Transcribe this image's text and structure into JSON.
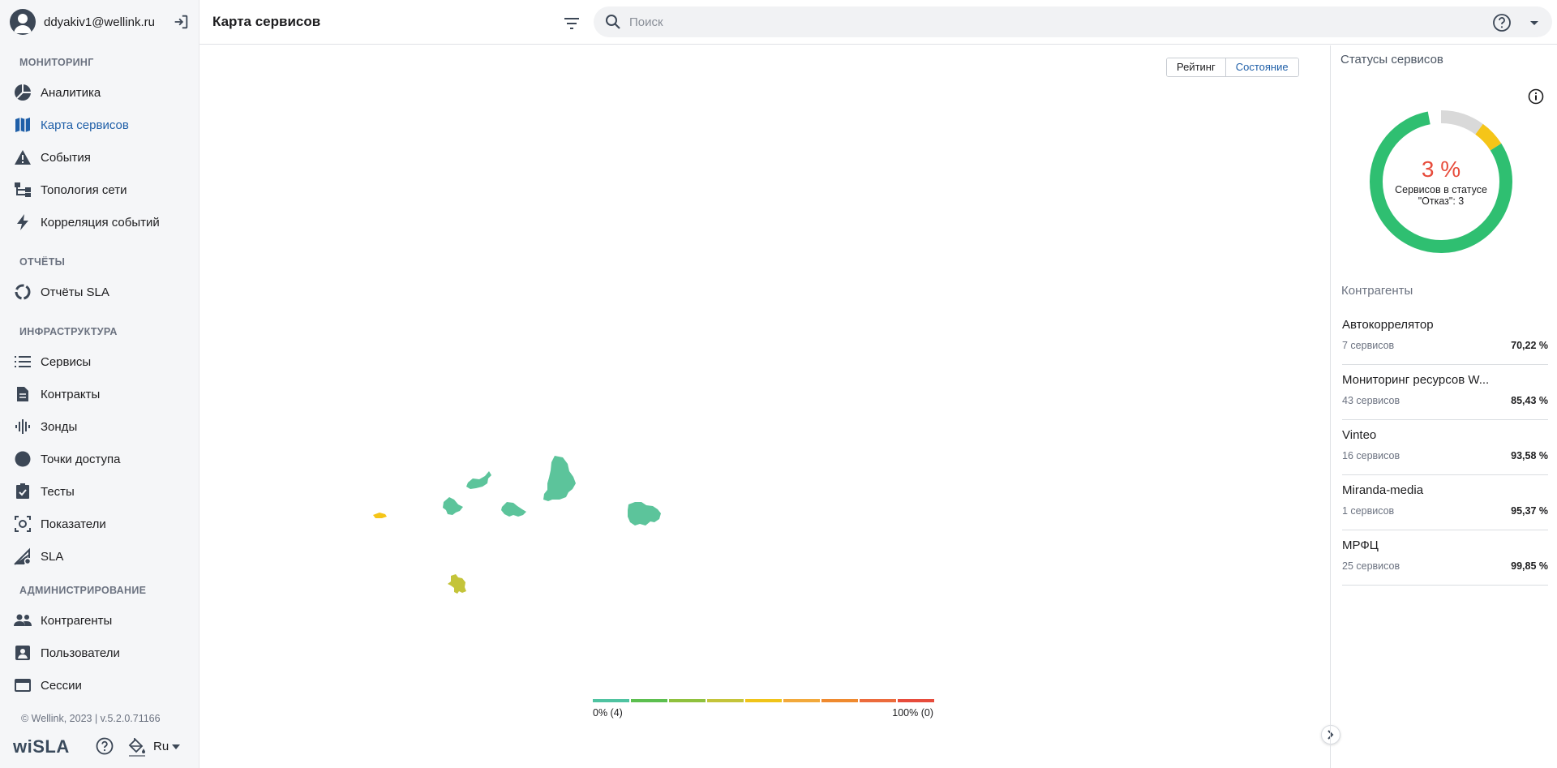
{
  "user": {
    "email": "ddyakiv1@wellink.ru"
  },
  "sidebar": {
    "sections": [
      {
        "title": "МОНИТОРИНГ"
      },
      {
        "title": "ОТЧЁТЫ"
      },
      {
        "title": "ИНФРАСТРУКТУРА"
      },
      {
        "title": "АДМИНИСТРИРОВАНИЕ"
      }
    ],
    "items": [
      {
        "label": "Аналитика",
        "icon": "analytics-icon"
      },
      {
        "label": "Карта сервисов",
        "icon": "map-icon",
        "active": true
      },
      {
        "label": "События",
        "icon": "warning-icon"
      },
      {
        "label": "Топология сети",
        "icon": "topology-icon"
      },
      {
        "label": "Корреляция событий",
        "icon": "lightning-icon"
      },
      {
        "label": "Отчёты SLA",
        "icon": "report-icon"
      },
      {
        "label": "Сервисы",
        "icon": "list-icon"
      },
      {
        "label": "Контракты",
        "icon": "document-icon"
      },
      {
        "label": "Зонды",
        "icon": "probe-icon"
      },
      {
        "label": "Точки доступа",
        "icon": "circle-icon"
      },
      {
        "label": "Тесты",
        "icon": "checklist-icon"
      },
      {
        "label": "Показатели",
        "icon": "metrics-icon"
      },
      {
        "label": "SLA",
        "icon": "sla-icon"
      },
      {
        "label": "Контрагенты",
        "icon": "people-icon"
      },
      {
        "label": "Пользователи",
        "icon": "user-badge-icon"
      },
      {
        "label": "Сессии",
        "icon": "window-icon"
      }
    ],
    "copyright": "© Wellink, 2023 | v.5.2.0.71166",
    "logo": "wiSLA",
    "language": "Ru"
  },
  "header": {
    "title": "Карта сервисов",
    "search_placeholder": "Поиск"
  },
  "map": {
    "toggle": {
      "rating": "Рейтинг",
      "state": "Состояние",
      "selected": "Состояние"
    },
    "legend": {
      "min_label": "0% (4)",
      "max_label": "100% (0)",
      "colors": [
        "#4fc3a1",
        "#5cbf4f",
        "#8fc13e",
        "#c4c43a",
        "#f0c419",
        "#f2a93b",
        "#ef8a2f",
        "#ec6b3c",
        "#e74c3c"
      ]
    }
  },
  "panel": {
    "title": "Статусы сервисов",
    "donut": {
      "percent": "3 %",
      "caption": "Сервисов в статусе \"Отказ\": 3",
      "segments": [
        {
          "status": "ok",
          "fraction": 0.81,
          "color": "#2fbf71"
        },
        {
          "status": "failure",
          "fraction": 0.03,
          "color": "#e74c3c"
        },
        {
          "status": "unknown",
          "fraction": 0.1,
          "color": "#d9d9d9"
        },
        {
          "status": "warning",
          "fraction": 0.06,
          "color": "#f5c518"
        }
      ]
    },
    "counterparties_title": "Контрагенты",
    "counterparties": [
      {
        "name": "Автокоррелятор",
        "count": "7 сервисов",
        "percent": "70,22 %"
      },
      {
        "name": "Мониторинг ресурсов W...",
        "count": "43 сервисов",
        "percent": "85,43 %"
      },
      {
        "name": "Vinteo",
        "count": "16 сервисов",
        "percent": "93,58 %"
      },
      {
        "name": "Miranda-media",
        "count": "1 сервисов",
        "percent": "95,37 %"
      },
      {
        "name": "МРФЦ",
        "count": "25 сервисов",
        "percent": "99,85 %"
      }
    ]
  }
}
